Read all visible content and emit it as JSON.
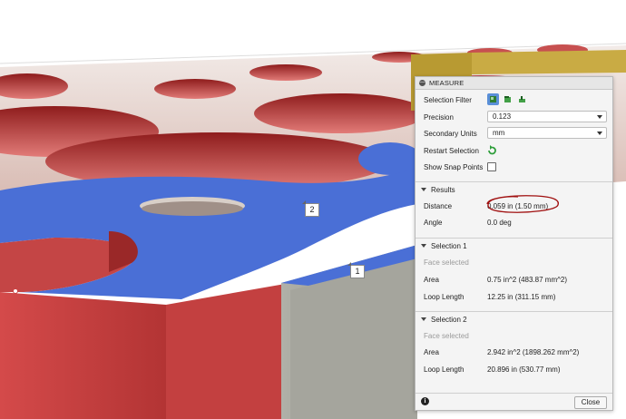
{
  "viewport": {
    "markers": [
      "2",
      "1"
    ]
  },
  "panel": {
    "title": "MEASURE",
    "selection_filter_label": "Selection Filter",
    "filter_icons": [
      "select-body-icon",
      "select-face-icon",
      "select-edge-icon"
    ],
    "precision_label": "Precision",
    "precision_value": "0.123",
    "secondary_units_label": "Secondary Units",
    "secondary_units_value": "mm",
    "restart_selection_label": "Restart Selection",
    "show_snap_points_label": "Show Snap Points",
    "show_snap_points_checked": false,
    "results": {
      "header": "Results",
      "distance_label": "Distance",
      "distance_value": "0.059 in (1.50 mm)",
      "angle_label": "Angle",
      "angle_value": "0.0 deg"
    },
    "selection1": {
      "header": "Selection 1",
      "status": "Face selected",
      "area_label": "Area",
      "area_value": "0.75 in^2 (483.87 mm^2)",
      "loop_label": "Loop Length",
      "loop_value": "12.25 in (311.15 mm)"
    },
    "selection2": {
      "header": "Selection 2",
      "status": "Face selected",
      "area_label": "Area",
      "area_value": "2.942 in^2 (1898.262 mm^2)",
      "loop_label": "Loop Length",
      "loop_value": "20.896 in (530.77 mm)"
    },
    "close_label": "Close"
  },
  "colors": {
    "red_face": "#c94a4a",
    "blue_face": "#4a6fd6",
    "gray_face": "#9a9a92",
    "gold_face": "#b89a32",
    "annotation": "#a01010"
  }
}
